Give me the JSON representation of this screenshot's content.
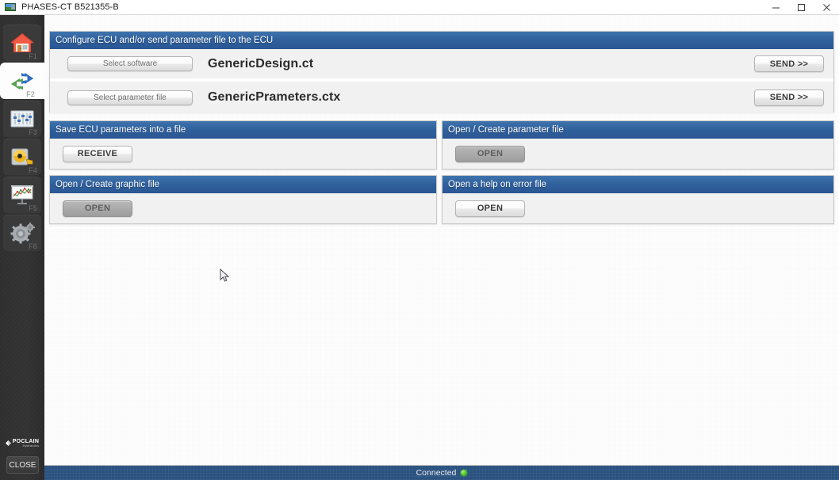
{
  "window": {
    "title": "PHASES-CT B521355-B",
    "app_icon": "app-window-icon",
    "controls": {
      "minimize": "minimize-icon",
      "maximize": "maximize-icon",
      "close": "close-icon"
    }
  },
  "sidebar": {
    "items": [
      {
        "icon": "home-icon",
        "key": "F1",
        "selected": false
      },
      {
        "icon": "exchange-arrows-icon",
        "key": "F2",
        "selected": true
      },
      {
        "icon": "sliders-icon",
        "key": "F3",
        "selected": false
      },
      {
        "icon": "measuring-tape-icon",
        "key": "F4",
        "selected": false
      },
      {
        "icon": "chart-board-icon",
        "key": "F5",
        "selected": false
      },
      {
        "icon": "gears-icon",
        "key": "F6",
        "selected": false
      }
    ],
    "brand": {
      "name": "POCLAIN",
      "subtitle": "Hydraulics",
      "mark": "poclain-logo-icon"
    },
    "close_label": "CLOSE"
  },
  "panels": {
    "configure": {
      "title": "Configure ECU and/or send parameter file to the ECU",
      "rows": [
        {
          "select_label": "Select software",
          "filename": "GenericDesign.ct",
          "send_label": "SEND >>"
        },
        {
          "select_label": "Select parameter file",
          "filename": "GenericPrameters.ctx",
          "send_label": "SEND >>"
        }
      ]
    },
    "save_params": {
      "title": "Save ECU parameters into a file",
      "button_label": "RECEIVE",
      "button_disabled": false
    },
    "param_file": {
      "title": "Open / Create parameter file",
      "button_label": "OPEN",
      "button_disabled": true
    },
    "graphic_file": {
      "title": "Open / Create graphic file",
      "button_label": "OPEN",
      "button_disabled": true
    },
    "help_error": {
      "title": "Open a help on error file",
      "button_label": "OPEN",
      "button_disabled": false
    }
  },
  "statusbar": {
    "text": "Connected",
    "indicator": "status-dot-green"
  },
  "colors": {
    "header_blue": "#2f5f9c",
    "statusbar_blue": "#2a5280",
    "sidebar_dark": "#2f2f2f",
    "connected_green": "#4ec526",
    "panel_body": "#f1f1f1"
  }
}
